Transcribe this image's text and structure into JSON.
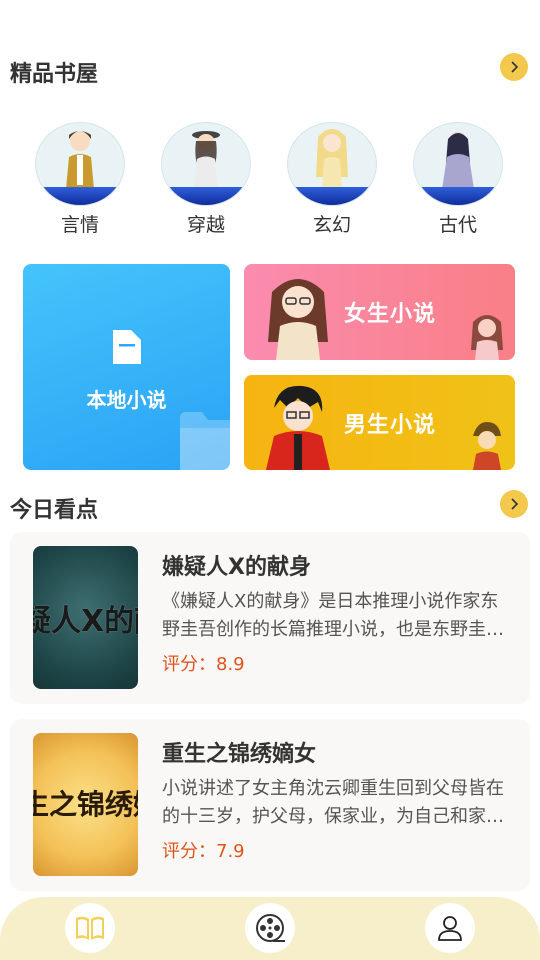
{
  "section1": {
    "title": "精品书屋"
  },
  "genres": [
    {
      "label": "言情"
    },
    {
      "label": "穿越"
    },
    {
      "label": "玄幻"
    },
    {
      "label": "古代"
    }
  ],
  "cards": {
    "local": "本地小说",
    "girl": "女生小说",
    "boy": "男生小说"
  },
  "section2": {
    "title": "今日看点"
  },
  "books": [
    {
      "title": "嫌疑人X的献身",
      "desc": "《嫌疑人X的献身》是日本推理小说作家东野圭吾创作的长篇推理小说，也是东野圭吾的代表作之一。",
      "score": "评分：8.9",
      "cover_text": "疑人X的献"
    },
    {
      "title": "重生之锦绣嫡女",
      "desc": "小说讲述了女主角沈云卿重生回到父母皆在的十三岁，护父母，保家业，为自己和家人改写命运。",
      "score": "评分：7.9",
      "cover_text": "生之锦绣嫡"
    }
  ],
  "tabbar": {
    "icons": [
      "book-icon",
      "film-reel-icon",
      "user-icon"
    ]
  },
  "colors": {
    "accent": "#f2c94c",
    "score": "#e0541c",
    "tabbar_bg": "#f7efc9"
  }
}
